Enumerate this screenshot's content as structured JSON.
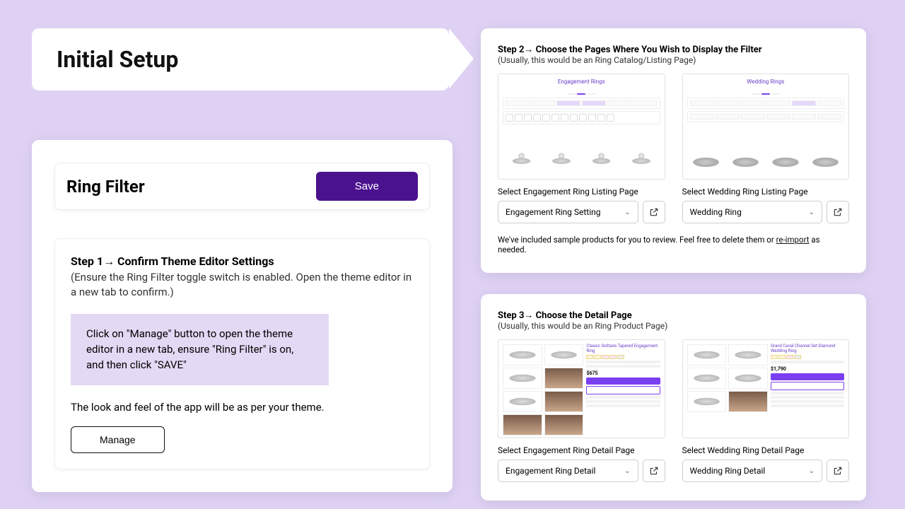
{
  "title": "Initial Setup",
  "header": {
    "title": "Ring Filter",
    "save": "Save"
  },
  "step1": {
    "head": "Step 1→  Confirm Theme Editor Settings",
    "sub": "(Ensure the Ring Filter toggle switch is enabled. Open the theme editor in a new tab to confirm.)",
    "info": "Click on \"Manage\" button to open the theme editor in a new tab, ensure \"Ring Filter\" is on, and then click \"SAVE\"",
    "note": "The look and feel of the app will be as per your theme.",
    "manage": "Manage"
  },
  "step2": {
    "head": "Step 2→ Choose the Pages Where You Wish to Display the Filter",
    "sub": "(Usually, this would be an Ring Catalog/Listing Page)",
    "left": {
      "mock_title": "Engagement Rings",
      "label": "Select Engagement Ring Listing Page",
      "value": "Engagement Ring Setting"
    },
    "right": {
      "mock_title": "Wedding Rings",
      "label": "Select Wedding Ring Listing Page",
      "value": "Wedding Ring"
    },
    "sample_a": "We've included sample products for you to review. Feel free to delete them or ",
    "sample_link": "re-import",
    "sample_b": " as needed."
  },
  "step3": {
    "head": "Step 3→ Choose the Detail Page",
    "sub": "(Usually, this would be an Ring Product Page)",
    "left": {
      "ptitle": "Classic Solitaire Tapered Engagement Ring",
      "price": "$675",
      "label": "Select Engagement Ring Detail Page",
      "value": "Engagement Ring Detail"
    },
    "right": {
      "ptitle": "Grand Canal Channel Set Diamond Wedding Ring",
      "price": "$1,790",
      "label": "Select Wedding Ring Detail Page",
      "value": "Wedding Ring Detail"
    }
  }
}
